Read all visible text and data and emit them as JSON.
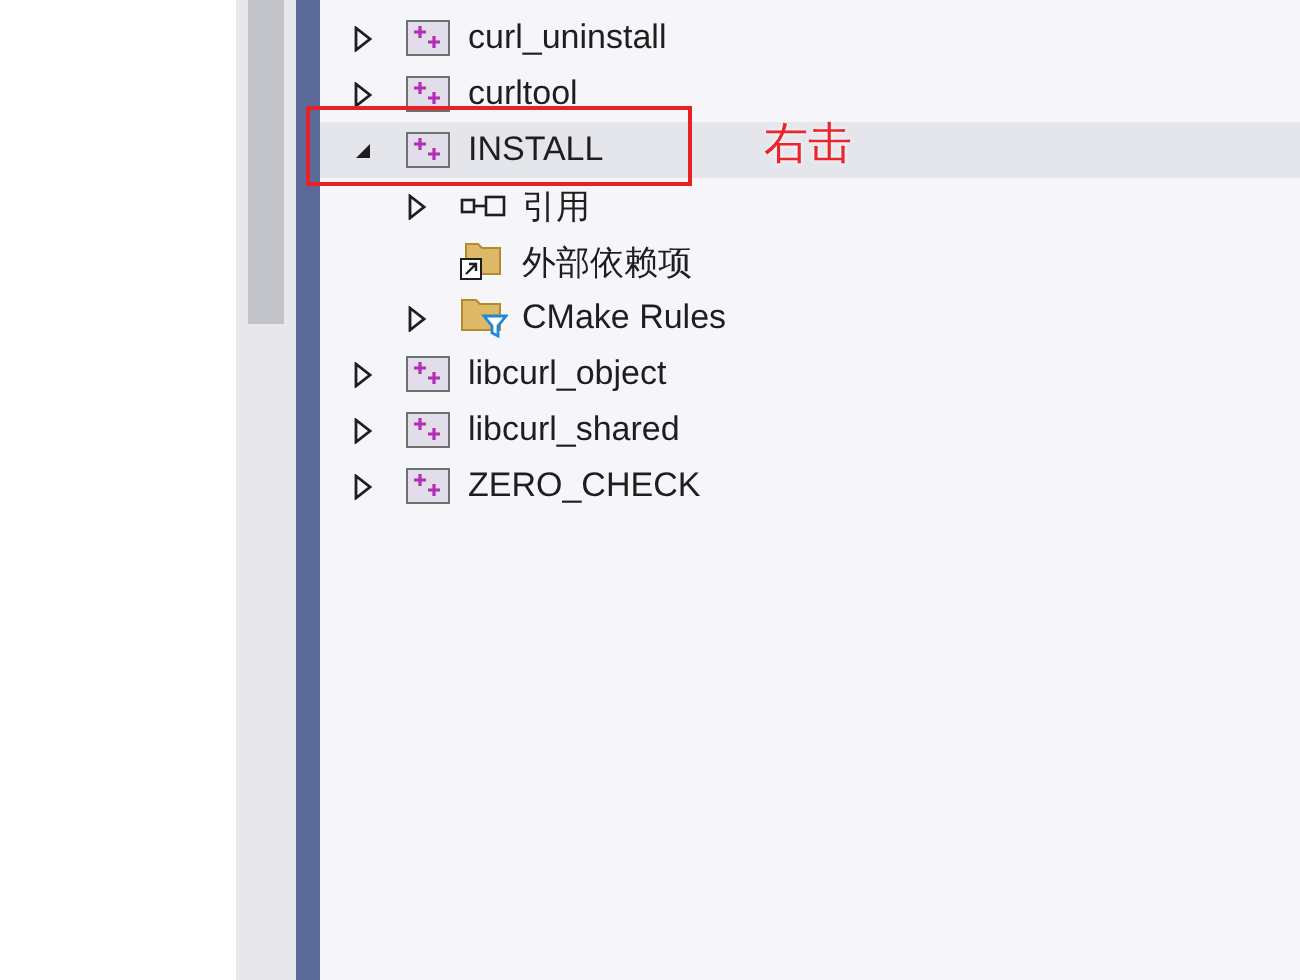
{
  "tree": [
    {
      "label": "curl_uninstall",
      "kind": "project",
      "expandable": true,
      "expanded": false,
      "selected": false,
      "boxed": false
    },
    {
      "label": "curltool",
      "kind": "project",
      "expandable": true,
      "expanded": false,
      "selected": false,
      "boxed": false
    },
    {
      "label": "INSTALL",
      "kind": "project",
      "expandable": true,
      "expanded": true,
      "selected": true,
      "boxed": true,
      "children": [
        {
          "label": "引用",
          "kind": "references",
          "expandable": true,
          "expanded": false,
          "selected": false,
          "boxed": false
        },
        {
          "label": "外部依赖项",
          "kind": "external",
          "expandable": false,
          "selected": false,
          "boxed": false
        },
        {
          "label": "CMake Rules",
          "kind": "filter-folder",
          "expandable": true,
          "expanded": false,
          "selected": false,
          "boxed": false
        }
      ]
    },
    {
      "label": "libcurl_object",
      "kind": "project",
      "expandable": true,
      "expanded": false,
      "selected": false,
      "boxed": false
    },
    {
      "label": "libcurl_shared",
      "kind": "project",
      "expandable": true,
      "expanded": false,
      "selected": false,
      "boxed": false
    },
    {
      "label": "ZERO_CHECK",
      "kind": "project",
      "expandable": true,
      "expanded": false,
      "selected": false,
      "boxed": false
    }
  ],
  "annotation": {
    "text": "右击"
  }
}
